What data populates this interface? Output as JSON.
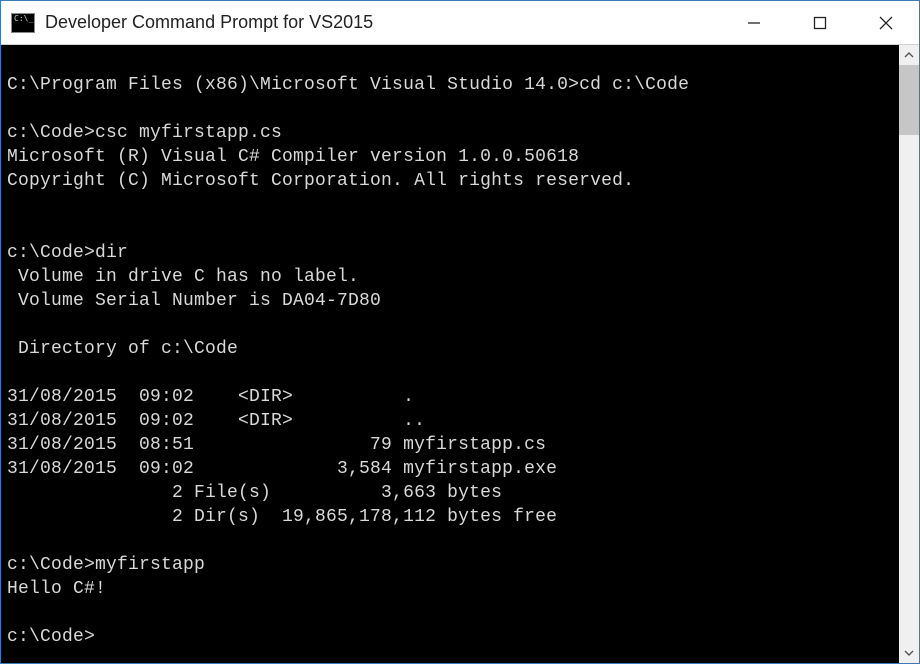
{
  "window": {
    "title": "Developer Command Prompt for VS2015",
    "icon_text": "C:\\_"
  },
  "terminal": {
    "lines": [
      "",
      "C:\\Program Files (x86)\\Microsoft Visual Studio 14.0>cd c:\\Code",
      "",
      "c:\\Code>csc myfirstapp.cs",
      "Microsoft (R) Visual C# Compiler version 1.0.0.50618",
      "Copyright (C) Microsoft Corporation. All rights reserved.",
      "",
      "",
      "c:\\Code>dir",
      " Volume in drive C has no label.",
      " Volume Serial Number is DA04-7D80",
      "",
      " Directory of c:\\Code",
      "",
      "31/08/2015  09:02    <DIR>          .",
      "31/08/2015  09:02    <DIR>          ..",
      "31/08/2015  08:51                79 myfirstapp.cs",
      "31/08/2015  09:02             3,584 myfirstapp.exe",
      "               2 File(s)          3,663 bytes",
      "               2 Dir(s)  19,865,178,112 bytes free",
      "",
      "c:\\Code>myfirstapp",
      "Hello C#!",
      "",
      "c:\\Code>"
    ]
  }
}
